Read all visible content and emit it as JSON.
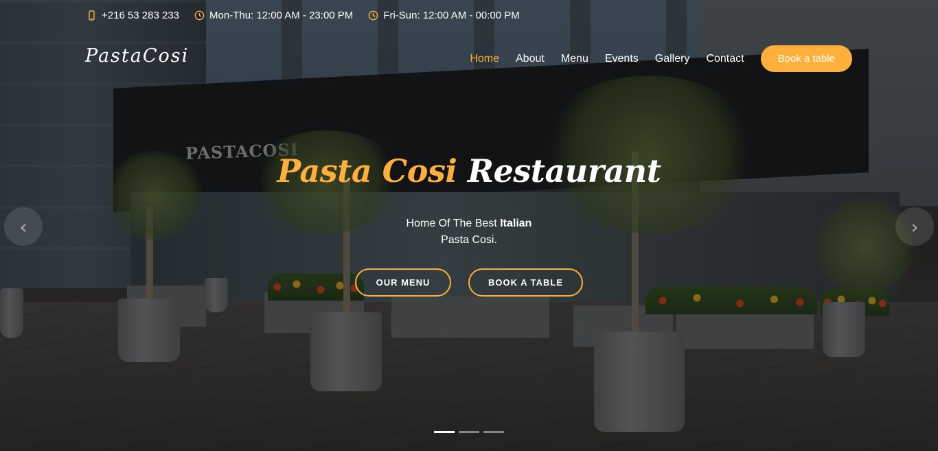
{
  "topbar": {
    "phone": "+216 53 283 233",
    "hours_weekdays": "Mon-Thu: 12:00 AM - 23:00 PM",
    "hours_weekend": "Fri-Sun: 12:00 AM - 00:00 PM",
    "phone_icon": "mobile-phone-icon",
    "clock_icon": "clock-icon"
  },
  "header": {
    "logo": "PastaCosi",
    "nav": [
      {
        "label": "Home",
        "active": true
      },
      {
        "label": "About",
        "active": false
      },
      {
        "label": "Menu",
        "active": false
      },
      {
        "label": "Events",
        "active": false
      },
      {
        "label": "Gallery",
        "active": false
      },
      {
        "label": "Contact",
        "active": false
      }
    ],
    "cta": "Book a table"
  },
  "hero": {
    "title_accent": "Pasta Cosi",
    "title_rest": "Restaurant",
    "subtitle_prefix": "Home Of The Best",
    "subtitle_bold": "Italian",
    "subtitle_line2": "Pasta Cosi.",
    "buttons": {
      "menu": "OUR MENU",
      "table": "BOOK A TABLE"
    },
    "storefront_sign": "PASTACOSI"
  },
  "carousel": {
    "prev_icon": "chevron-left-icon",
    "next_icon": "chevron-right-icon",
    "slides": 3,
    "active_slide": 1
  },
  "colors": {
    "accent": "#ffb03b",
    "text": "#ffffff"
  }
}
